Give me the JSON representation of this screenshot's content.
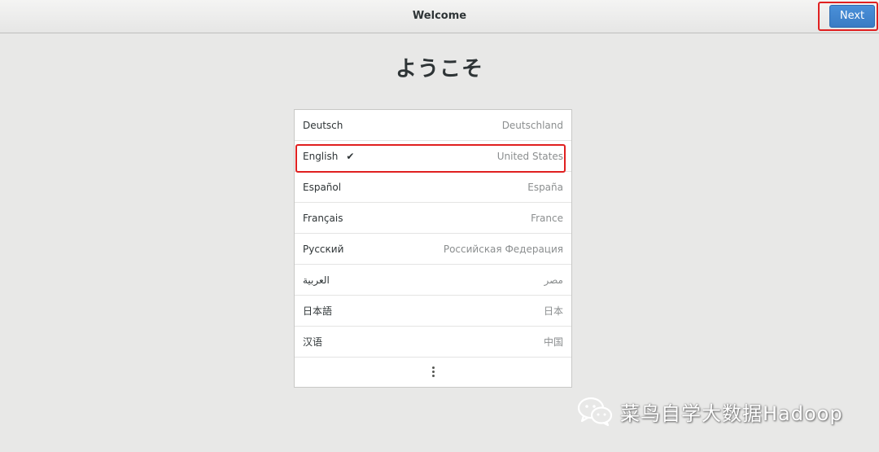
{
  "header": {
    "title": "Welcome",
    "next_label": "Next"
  },
  "welcome": {
    "title": "ようこそ"
  },
  "languages": [
    {
      "name": "Deutsch",
      "region": "Deutschland",
      "selected": false
    },
    {
      "name": "English",
      "region": "United States",
      "selected": true
    },
    {
      "name": "Español",
      "region": "España",
      "selected": false
    },
    {
      "name": "Français",
      "region": "France",
      "selected": false
    },
    {
      "name": "Русский",
      "region": "Российская Федерация",
      "selected": false
    },
    {
      "name": "العربية",
      "region": "مصر",
      "selected": false
    },
    {
      "name": "日本語",
      "region": "日本",
      "selected": false
    },
    {
      "name": "汉语",
      "region": "中国",
      "selected": false
    }
  ],
  "icons": {
    "check": "check-icon",
    "more": "more-vertical-icon",
    "watermark": "wechat-icon"
  },
  "watermark": {
    "text": "菜鸟自学大数据Hadoop"
  },
  "colors": {
    "accent": "#4a90d9",
    "highlight": "#e02020",
    "background": "#e8e8e7"
  }
}
